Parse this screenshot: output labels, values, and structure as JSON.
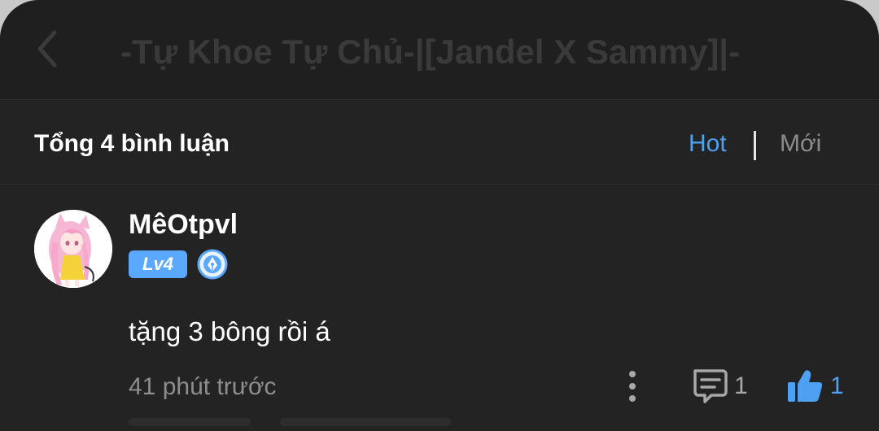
{
  "header": {
    "title": "-Tự Khoe Tự Chủ-|[Jandel X Sammy]|-",
    "back_icon": "chevron-left-icon"
  },
  "comments_header": {
    "count_label": "Tổng 4 bình luận",
    "sort_hot": "Hot",
    "sort_new": "Mới",
    "active_sort": "Hot"
  },
  "comment": {
    "username": "MêOtpvl",
    "level": "Lv4",
    "badge_icon": "pen-nib-badge-icon",
    "text": "tặng 3 bông rồi á",
    "timestamp": "41 phút trước",
    "reply_count": "1",
    "like_count": "1"
  },
  "colors": {
    "accent": "#4ea0f2",
    "background": "#232323",
    "level_badge": "#5aa8ff"
  }
}
